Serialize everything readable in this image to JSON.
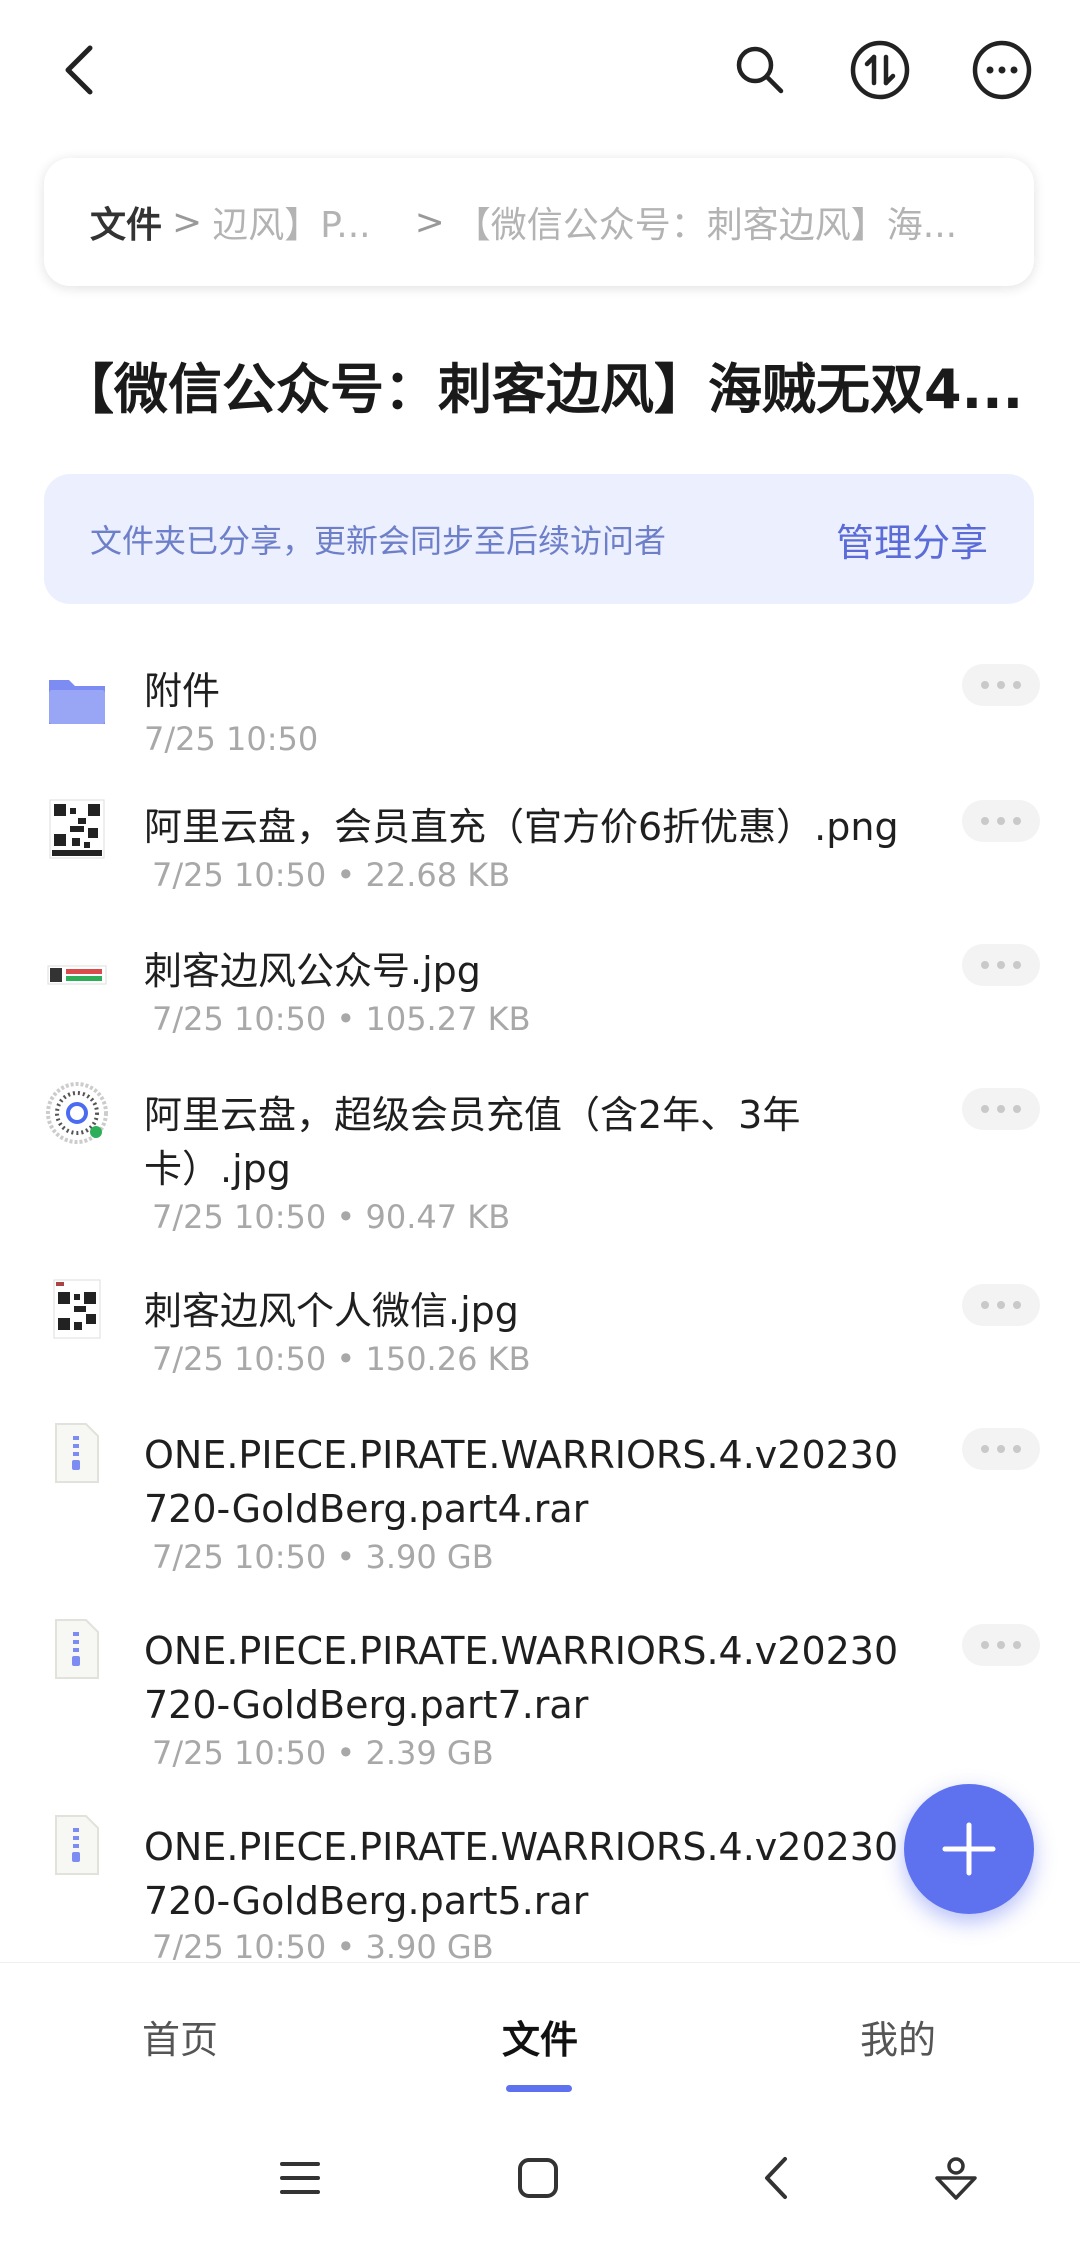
{
  "header": {
    "back_icon": "chevron-left-icon",
    "search_icon": "search-icon",
    "sort_icon": "sort-updown-icon",
    "more_icon": "more-horizontal-icon"
  },
  "breadcrumb": {
    "root": "文件",
    "sep1": ">",
    "item1": "辺风】P...",
    "sep2": ">",
    "item2": "【微信公众号：刺客边风】海..."
  },
  "folder": {
    "title": "【微信公众号：刺客边风】海贼无双4..."
  },
  "share_banner": {
    "text": "文件夹已分享，更新会同步至后续访问者",
    "manage_label": "管理分享"
  },
  "files": [
    {
      "name": "附件",
      "meta": "7/25 10:50",
      "type": "folder"
    },
    {
      "name": "阿里云盘，会员直充（官方价6折优惠）.png",
      "meta": "7/25 10:50 • 22.68 KB",
      "type": "image-qr"
    },
    {
      "name": "刺客边风公众号.jpg",
      "meta": "7/25 10:50 • 105.27 KB",
      "type": "image-banner"
    },
    {
      "name": "阿里云盘，超级会员充值（含2年、3年卡）.jpg",
      "meta": "7/25 10:50 • 90.47 KB",
      "type": "image-round-qr"
    },
    {
      "name": "刺客边风个人微信.jpg",
      "meta": "7/25 10:50 • 150.26 KB",
      "type": "image-qr"
    },
    {
      "name": "ONE.PIECE.PIRATE.WARRIORS.4.v20230720-GoldBerg.part4.rar",
      "meta": "7/25 10:50 • 3.90 GB",
      "type": "archive"
    },
    {
      "name": "ONE.PIECE.PIRATE.WARRIORS.4.v20230720-GoldBerg.part7.rar",
      "meta": "7/25 10:50 • 2.39 GB",
      "type": "archive"
    },
    {
      "name": "ONE.PIECE.PIRATE.WARRIORS.4.v20230720-GoldBerg.part5.rar",
      "meta": "7/25 10:50 • 3.90 GB",
      "type": "archive"
    }
  ],
  "fab": {
    "icon": "plus-icon"
  },
  "tabs": [
    {
      "label": "首页",
      "active": false
    },
    {
      "label": "文件",
      "active": true
    },
    {
      "label": "我的",
      "active": false
    }
  ],
  "system_nav": {
    "menu_icon": "menu-icon",
    "home_icon": "home-square-icon",
    "back_icon": "back-icon",
    "assist_icon": "assistant-icon"
  },
  "colors": {
    "accent": "#5e72f0",
    "banner_bg": "#eceffd",
    "folder_icon": "#7d8cf2"
  }
}
